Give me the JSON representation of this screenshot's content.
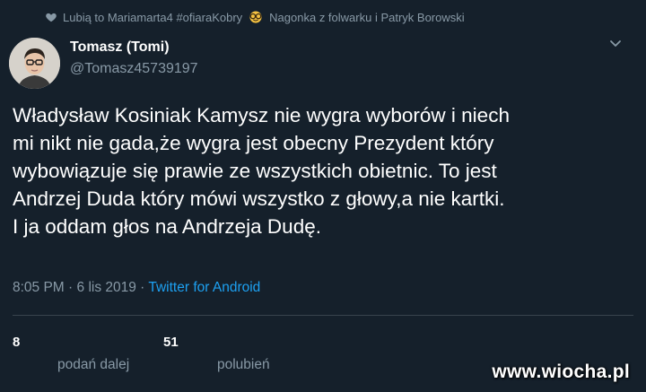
{
  "context": {
    "icon": "heart-icon",
    "text_before": "Lubią to Mariamarta4 #ofiaraKobry",
    "emoji": "nerd-face-glasses",
    "text_after": "Nagonka z folwarku i Patryk Borowski"
  },
  "author": {
    "name": "Tomasz (Tomi)",
    "handle": "@Tomasz45739197"
  },
  "tweet": {
    "lines": [
      "Władysław Kosiniak Kamysz  nie wygra wyborów i niech",
      "mi nikt nie gada,że wygra jest obecny Prezydent który",
      "wybowiązuje się prawie ze wszystkich obietnic. To jest",
      "Andrzej Duda który mówi wszystko z głowy,a nie kartki.",
      "I ja oddam głos na Andrzeja Dudę."
    ]
  },
  "meta": {
    "time": "8:05 PM",
    "sep1": " · ",
    "date": "6 lis 2019",
    "sep2": " · ",
    "source": "Twitter for Android"
  },
  "stats": {
    "retweets": {
      "count": "8",
      "label": "podań dalej"
    },
    "likes": {
      "count": "51",
      "label": "polubień"
    }
  },
  "watermark": "www.wiocha.pl",
  "colors": {
    "background": "#15202b",
    "secondary_text": "#8899a6",
    "link": "#1da1f2",
    "divider": "#38444d"
  }
}
